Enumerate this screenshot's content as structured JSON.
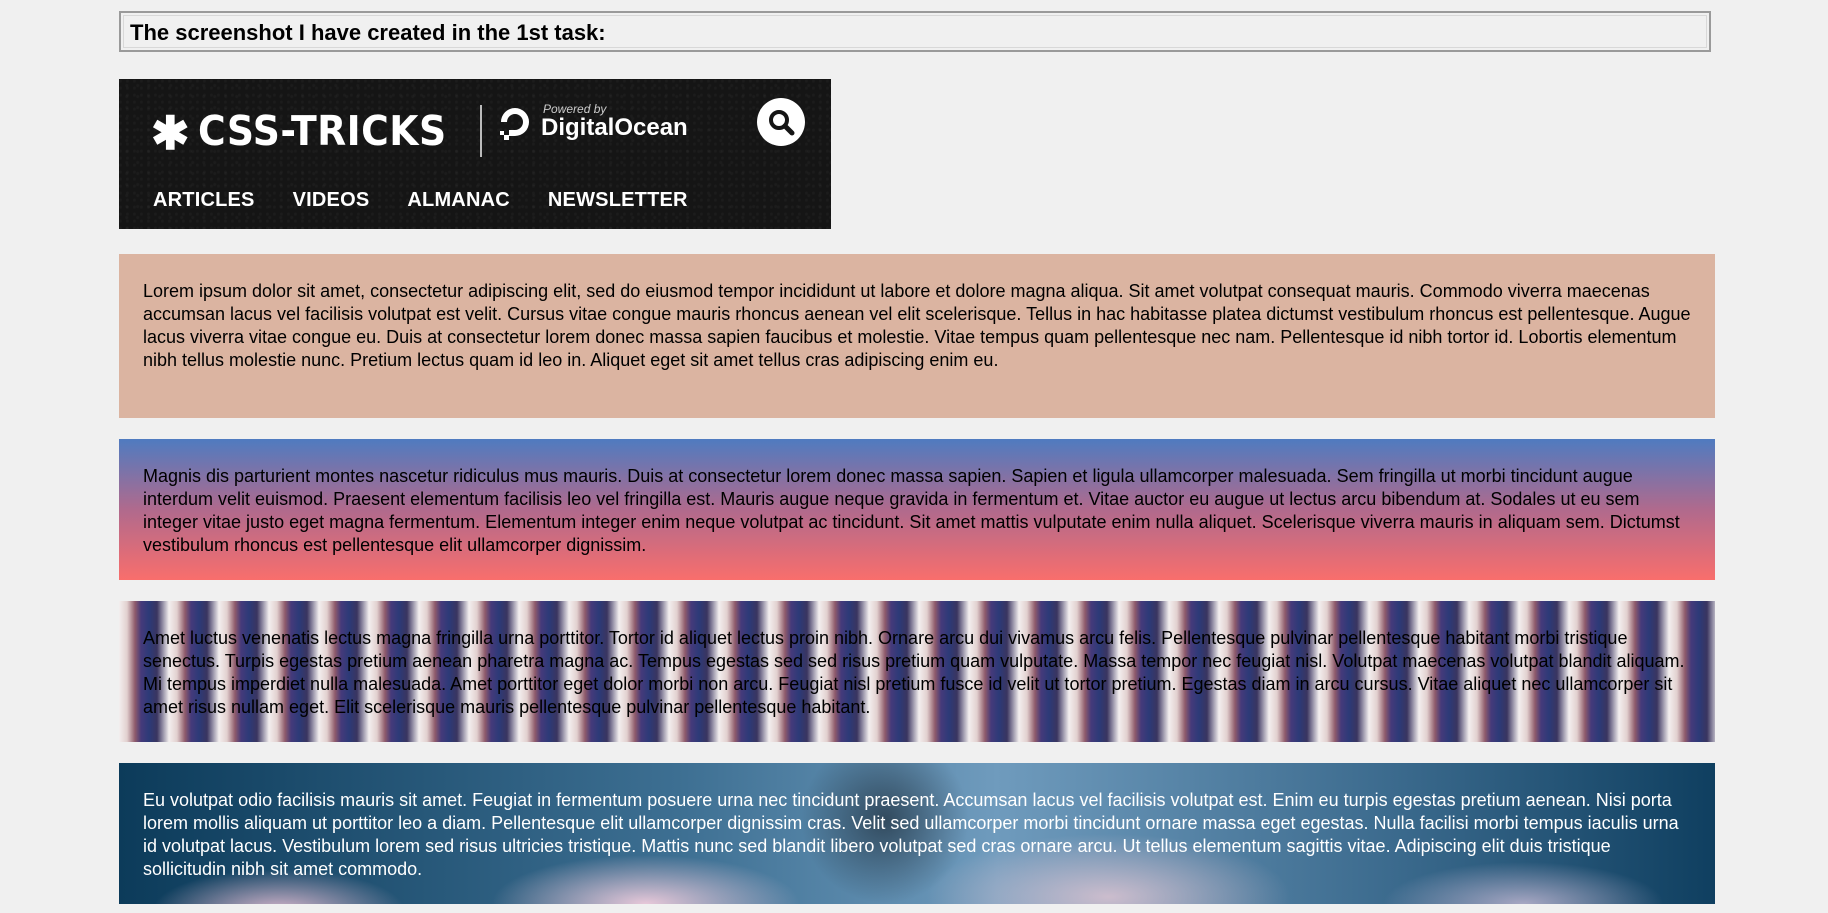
{
  "heading": "The screenshot I have created in the 1st task:",
  "banner": {
    "brand_star": "✱",
    "brand_name": "CSS-TRICKS",
    "powered_by": "Powered by",
    "sponsor_name": "DigitalOcean",
    "search_icon": "search-icon",
    "nav": [
      "ARTICLES",
      "VIDEOS",
      "ALMANAC",
      "NEWSLETTER"
    ]
  },
  "paragraphs": [
    "Lorem ipsum dolor sit amet, consectetur adipiscing elit, sed do eiusmod tempor incididunt ut labore et dolore magna aliqua. Sit amet volutpat consequat mauris. Commodo viverra maecenas accumsan lacus vel facilisis volutpat est velit. Cursus vitae congue mauris rhoncus aenean vel elit scelerisque. Tellus in hac habitasse platea dictumst vestibulum rhoncus est pellentesque. Augue lacus viverra vitae congue eu. Duis at consectetur lorem donec massa sapien faucibus et molestie. Vitae tempus quam pellentesque nec nam. Pellentesque id nibh tortor id. Lobortis elementum nibh tellus molestie nunc. Pretium lectus quam id leo in. Aliquet eget sit amet tellus cras adipiscing enim eu.",
    "Magnis dis parturient montes nascetur ridiculus mus mauris. Duis at consectetur lorem donec massa sapien. Sapien et ligula ullamcorper malesuada. Sem fringilla ut morbi tincidunt augue interdum velit euismod. Praesent elementum facilisis leo vel fringilla est. Mauris augue neque gravida in fermentum et. Vitae auctor eu augue ut lectus arcu bibendum at. Sodales ut eu sem integer vitae justo eget magna fermentum. Elementum integer enim neque volutpat ac tincidunt. Sit amet mattis vulputate enim nulla aliquet. Scelerisque viverra mauris in aliquam sem. Dictumst vestibulum rhoncus est pellentesque elit ullamcorper dignissim.",
    "Amet luctus venenatis lectus magna fringilla urna porttitor. Tortor id aliquet lectus proin nibh. Ornare arcu dui vivamus arcu felis. Pellentesque pulvinar pellentesque habitant morbi tristique senectus. Turpis egestas pretium aenean pharetra magna ac. Tempus egestas sed sed risus pretium quam vulputate. Massa tempor nec feugiat nisl. Volutpat maecenas volutpat blandit aliquam. Mi tempus imperdiet nulla malesuada. Amet porttitor eget dolor morbi non arcu. Feugiat nisl pretium fusce id velit ut tortor pretium. Egestas diam in arcu cursus. Vitae aliquet nec ullamcorper sit amet risus nullam eget. Elit scelerisque mauris pellentesque pulvinar pellentesque habitant.",
    "Eu volutpat odio facilisis mauris sit amet. Feugiat in fermentum posuere urna nec tincidunt praesent. Accumsan lacus vel facilisis volutpat est. Enim eu turpis egestas pretium aenean. Nisi porta lorem mollis aliquam ut porttitor leo a diam. Pellentesque elit ullamcorper dignissim cras. Velit sed ullamcorper morbi tincidunt ornare massa eget egestas. Nulla facilisi morbi tempus iaculis urna id volutpat lacus. Vestibulum lorem sed risus ultricies tristique. Mattis nunc sed blandit libero volutpat sed cras ornare arcu. Ut tellus elementum sagittis vitae. Adipiscing elit duis tristique sollicitudin nibh sit amet commodo."
  ]
}
